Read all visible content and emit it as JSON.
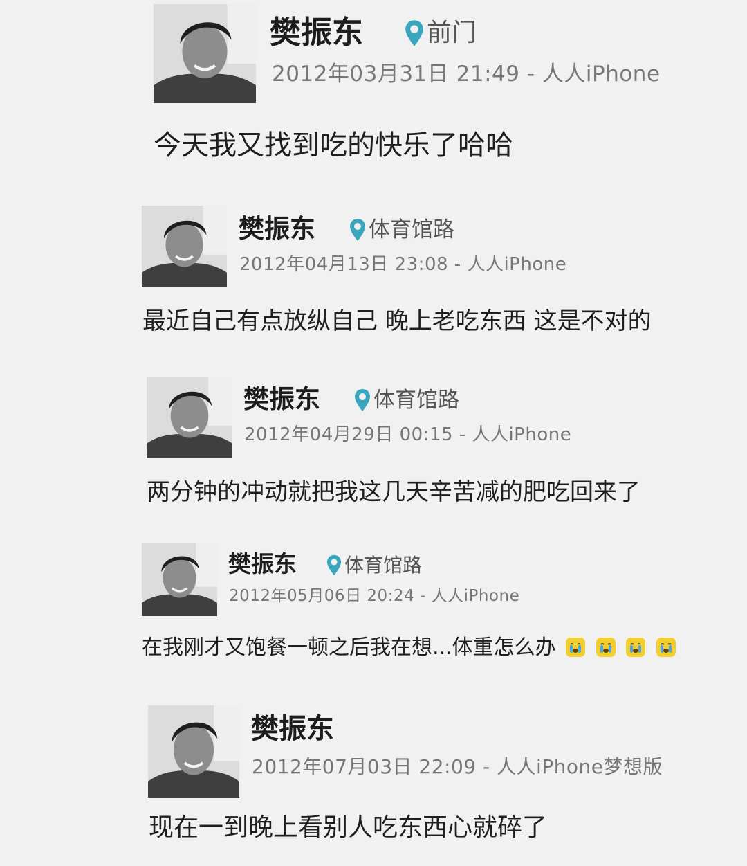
{
  "posts": [
    {
      "author": "樊振东",
      "location": "前门",
      "datetime": "2012年03月31日 21:49",
      "source": "人人iPhone",
      "content": "今天我又找到吃的快乐了哈哈"
    },
    {
      "author": "樊振东",
      "location": "体育馆路",
      "datetime": "2012年04月13日 23:08",
      "source": "人人iPhone",
      "content": "最近自己有点放纵自己 晚上老吃东西 这是不对的"
    },
    {
      "author": "樊振东",
      "location": "体育馆路",
      "datetime": "2012年04月29日 00:15",
      "source": "人人iPhone",
      "content": "两分钟的冲动就把我这几天辛苦减的肥吃回来了"
    },
    {
      "author": "樊振东",
      "location": "体育馆路",
      "datetime": "2012年05月06日 20:24",
      "source": "人人iPhone",
      "content": "在我刚才又饱餐一顿之后我在想...体重怎么办",
      "emoji_count": 4,
      "emoji_icon": "crying-face-icon"
    },
    {
      "author": "樊振东",
      "location": "",
      "datetime": "2012年07月03日 22:09",
      "source": "人人iPhone梦想版",
      "content": "现在一到晚上看别人吃东西心就碎了"
    }
  ],
  "separator": " - ",
  "colors": {
    "background": "#f1f1f2",
    "location_pin": "#3aa6bd",
    "emoji": "#f2cf2f"
  }
}
